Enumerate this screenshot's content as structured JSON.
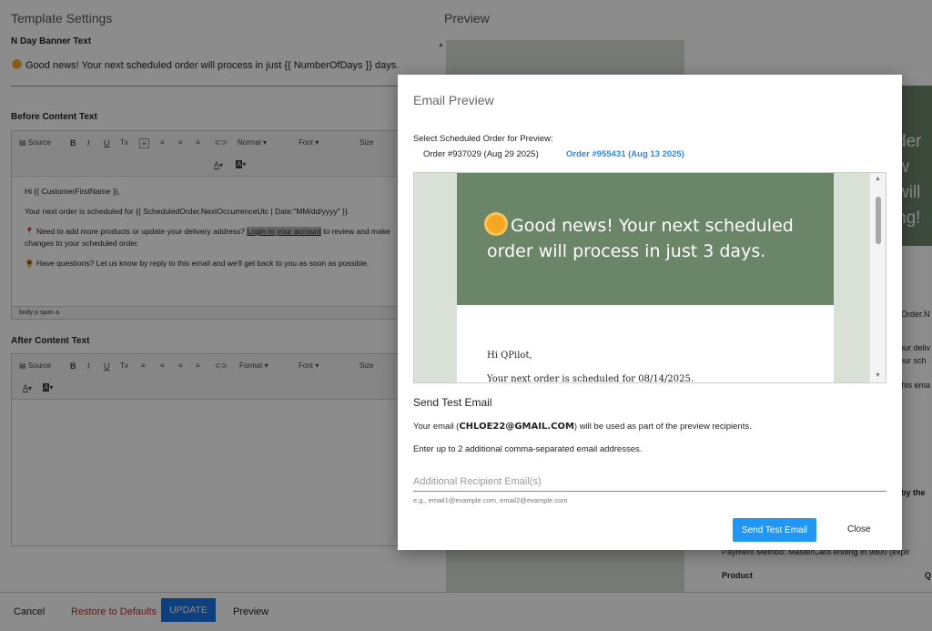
{
  "settings": {
    "title": "Template Settings",
    "banner_label": "N Day Banner Text",
    "banner_text": "Good news! Your next scheduled order will process in just {{ NumberOfDays }} days.",
    "before_label": "Before Content Text",
    "after_label": "After Content Text",
    "toolbar": {
      "source": "Source",
      "bold": "B",
      "italic": "I",
      "underline": "U",
      "clear": "Tx",
      "format_normal": "Normal",
      "format": "Format",
      "font": "Font",
      "size": "Size",
      "text_color": "A",
      "bg_color": "A"
    },
    "before_body": {
      "line1": "Hi {{ CustomerFirstName }},",
      "line2": "Your next order is scheduled for {{ ScheduledOrder.NextOccurrenceUtc | Date:\"MM/dd/yyyy\" }}.",
      "line3_pre": "Need to add more products or update your delivery address? ",
      "line3_link": "Login to your account",
      "line3_post": " to review and make changes to your scheduled order.",
      "line4": "Have questions? Let us know by reply to this email and we'll get back to you as soon as possible."
    },
    "pathbar": "body   p   span   a"
  },
  "preview_panel": {
    "title": "Preview",
    "banner_fragment": "der w will ng!",
    "frag1": "Order.N",
    "frag2": "our deliv",
    "frag3": "our sch",
    "frag4": "this ema",
    "frag5": "by the",
    "frag6": "Payment Method: MasterCard ending in 9800 (expir",
    "frag7": "Product",
    "frag8": "Q"
  },
  "footer": {
    "cancel": "Cancel",
    "restore": "Restore to Defaults",
    "update": "UPDATE",
    "preview": "Preview"
  },
  "modal": {
    "title": "Email Preview",
    "select_label": "Select Scheduled Order for Preview:",
    "orders": [
      {
        "label": "Order #937029 (Aug 29 2025)",
        "active": false
      },
      {
        "label": "Order #955431 (Aug 13 2025)",
        "active": true
      }
    ],
    "preview": {
      "banner": "Good news! Your next scheduled order will process in just 3 days.",
      "greeting": "Hi QPilot,",
      "scheduled": "Your next order is scheduled for 08/14/2025."
    },
    "send_section": "Send Test Email",
    "recipient_pre": "Your email (",
    "recipient_email": "CHLOE22@GMAIL.COM",
    "recipient_post": ") will be used as part of the preview recipients.",
    "extra_note": "Enter up to 2 additional comma-separated email addresses.",
    "input_placeholder": "Additional Recipient Email(s)",
    "hint": "e.g., email1@example.com, email2@example.com",
    "send_button": "Send Test Email",
    "close_button": "Close"
  },
  "colors": {
    "banner_green": "#6a8568",
    "accent_blue": "#2196f3",
    "restore_red": "#c62828"
  }
}
